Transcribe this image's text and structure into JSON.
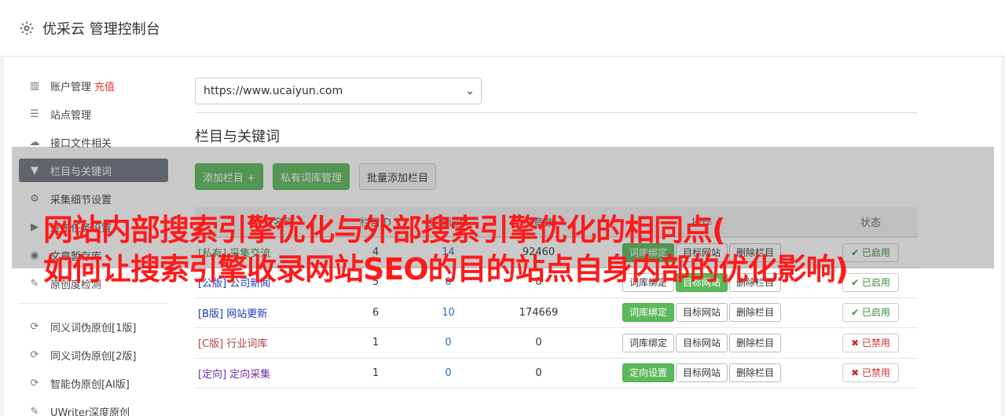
{
  "header": {
    "title": "优采云 管理控制台"
  },
  "sidebar": {
    "items": [
      {
        "label": "账户管理",
        "extra": "充值",
        "icon": "bar-chart-icon"
      },
      {
        "label": "站点管理",
        "icon": "server-icon"
      },
      {
        "label": "接口文件相关",
        "icon": "cloud-upload-icon"
      },
      {
        "label": "栏目与关键词",
        "icon": "filter-icon",
        "active": true
      },
      {
        "label": "采集细节设置",
        "icon": "cogs-icon"
      },
      {
        "label": "发布任务设置",
        "icon": "play-circle-icon"
      },
      {
        "label": "文章暂存库",
        "icon": "database-icon"
      },
      {
        "label": "原创度检测",
        "icon": "edit-icon"
      }
    ],
    "items2": [
      {
        "label": "同义词伪原创[1版]",
        "icon": "refresh-icon"
      },
      {
        "label": "同义词伪原创[2版]",
        "icon": "refresh-icon"
      },
      {
        "label": "智能伪原创[AI版]",
        "icon": "refresh-icon"
      },
      {
        "label": "UWriter深度原创",
        "icon": "edit-icon"
      }
    ]
  },
  "main": {
    "site_select": "https://www.ucaiyun.com",
    "section_title": "栏目与关键词",
    "buttons": {
      "add_column": "添加栏目 +",
      "private_lib": "私有词库管理",
      "batch_add": "批量添加栏目"
    },
    "table": {
      "headers": [
        "栏目名称",
        "栏目ID",
        "关键词数",
        "文章数",
        "操作",
        "状态"
      ],
      "rows": [
        {
          "tag": "[私有]",
          "name": "采集交流",
          "id": "4",
          "kw": "14",
          "articles": "92460",
          "bind": "词库绑定",
          "target": "目标网站",
          "delete": "删除栏目",
          "status": "✔ 已启用",
          "on": true
        },
        {
          "tag": "[公版]",
          "name": "公司新闻",
          "id": "5",
          "kw": "0",
          "articles": "0",
          "bind": "词库绑定",
          "target": "目标网站",
          "delete": "删除栏目",
          "status": "✔ 已启用",
          "on": true
        },
        {
          "tag": "[B版]",
          "name": "网站更新",
          "id": "6",
          "kw": "10",
          "articles": "174669",
          "bind": "词库绑定",
          "target": "目标网站",
          "delete": "删除栏目",
          "status": "✔ 已启用",
          "on": true
        },
        {
          "tag": "[C版]",
          "name": "行业词库",
          "id": "1",
          "kw": "0",
          "articles": "0",
          "bind": "词库绑定",
          "target": "目标网站",
          "delete": "删除栏目",
          "status": "✖ 已禁用",
          "on": false
        },
        {
          "tag": "[定向]",
          "name": "定向采集",
          "id": "1",
          "kw": "0",
          "articles": "0",
          "bind": "定向设置",
          "target": "目标网站",
          "delete": "删除栏目",
          "status": "✖ 已禁用",
          "on": false
        }
      ]
    }
  },
  "overlay": {
    "line1": "网站内部搜索引擎优化与外部搜索引擎优化的相同点(",
    "line2": "如何让搜索引擎收录网站SEO的目的站点自身内部的优化影响)"
  }
}
